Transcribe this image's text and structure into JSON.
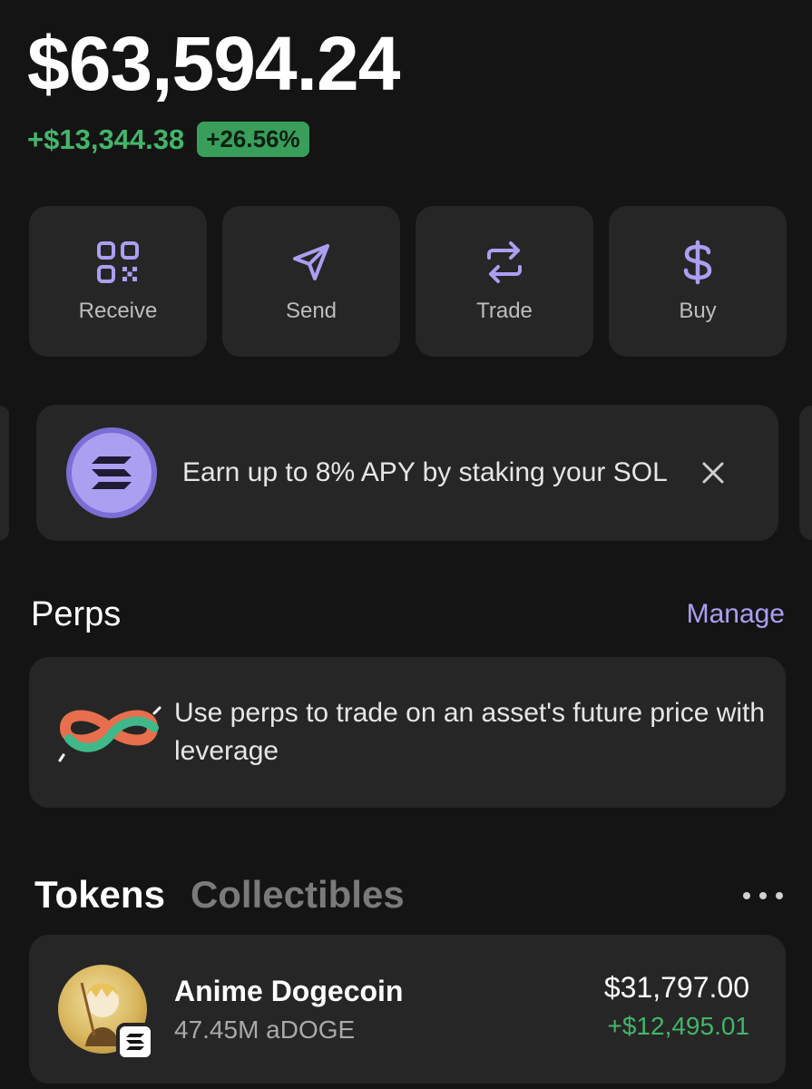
{
  "balance": {
    "total": "$63,594.24",
    "change_abs": "+$13,344.38",
    "change_pct": "+26.56%"
  },
  "actions": [
    {
      "label": "Receive",
      "icon": "qr-code-icon"
    },
    {
      "label": "Send",
      "icon": "send-icon"
    },
    {
      "label": "Trade",
      "icon": "swap-icon"
    },
    {
      "label": "Buy",
      "icon": "dollar-icon"
    }
  ],
  "promo": {
    "text": "Earn up to 8% APY by staking your SOL",
    "icon": "solana-logo-icon",
    "close_icon": "close-icon"
  },
  "perps": {
    "title": "Perps",
    "manage_label": "Manage",
    "description": "Use perps to trade on an asset's future price with leverage",
    "icon": "perps-icon"
  },
  "tabs": {
    "active": "Tokens",
    "inactive": "Collectibles"
  },
  "tokens": [
    {
      "name": "Anime Dogecoin",
      "amount": "47.45M aDOGE",
      "value": "$31,797.00",
      "change": "+$12,495.01"
    }
  ],
  "colors": {
    "background": "#141414",
    "card": "#262626",
    "accent": "#ab9ff2",
    "positive": "#43b56a"
  }
}
